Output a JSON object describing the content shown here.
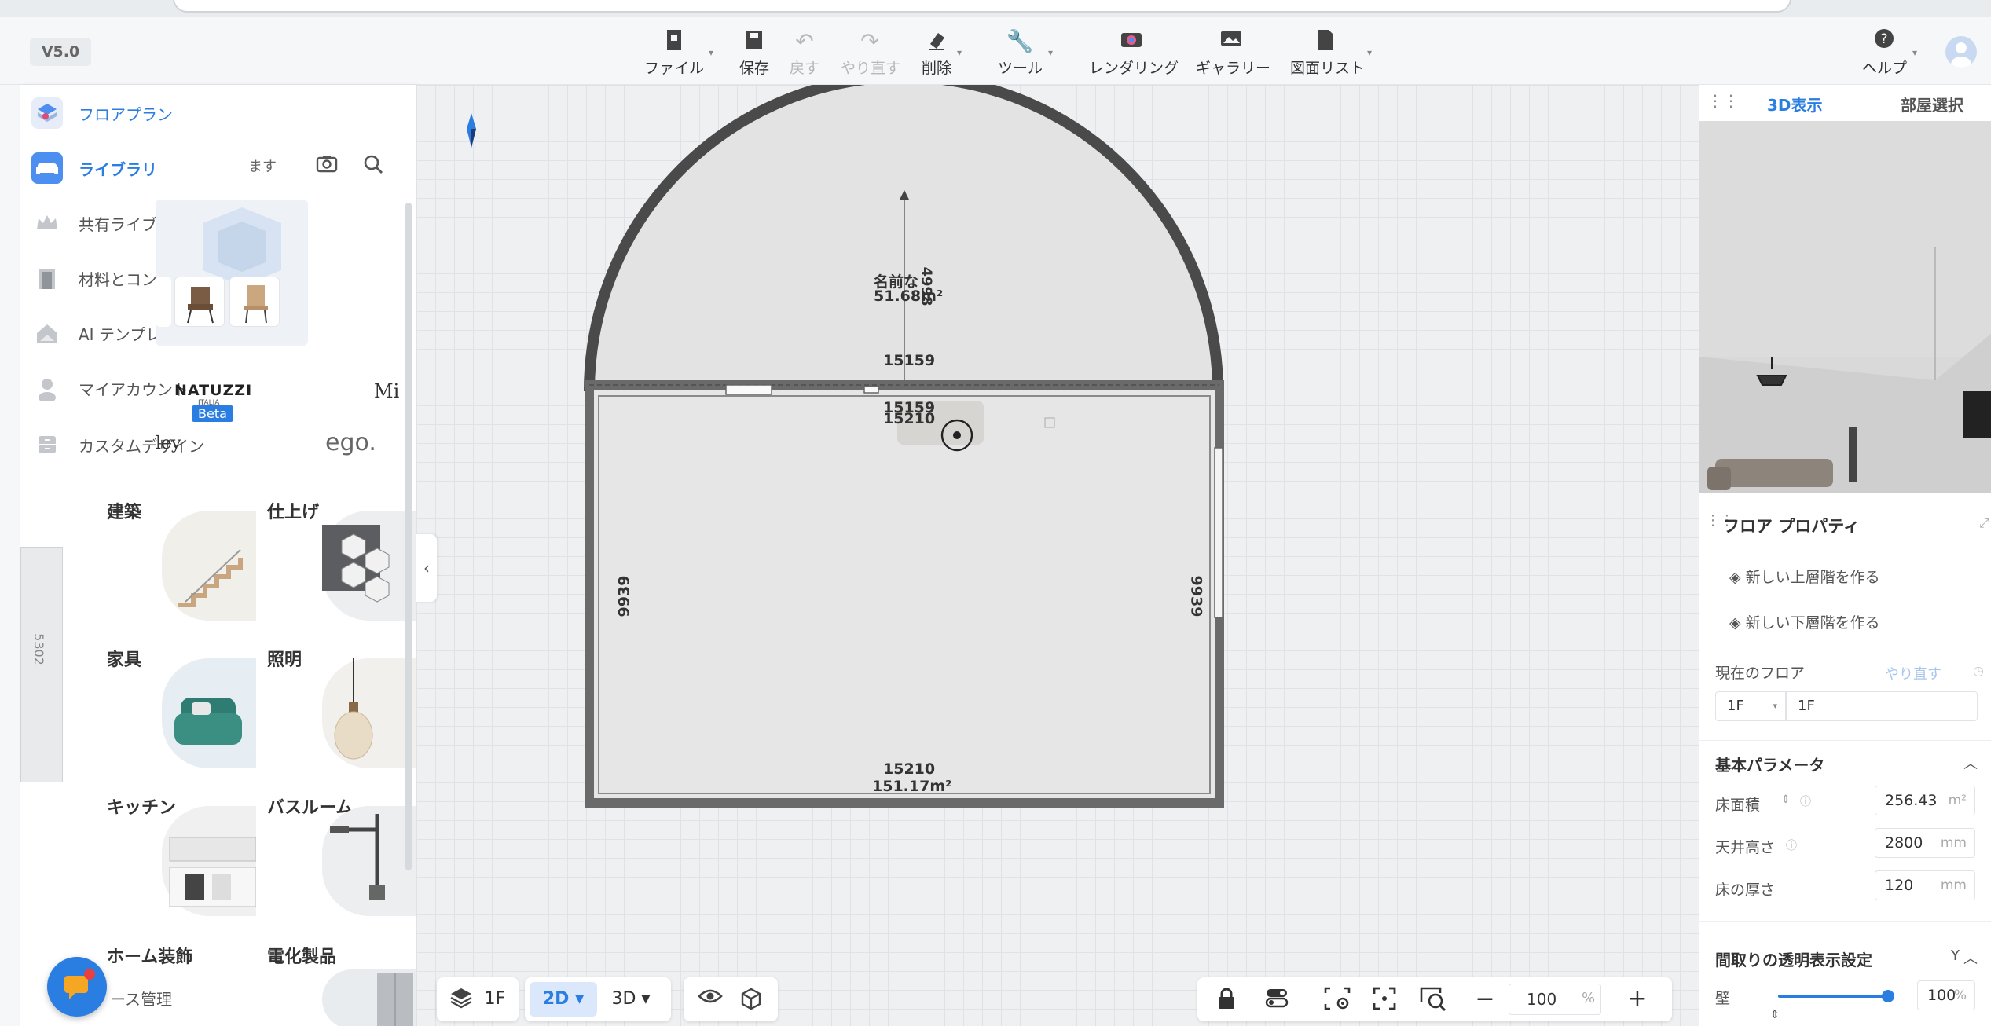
{
  "app": {
    "version": "V5.0"
  },
  "toolbar": {
    "file": "ファイル",
    "save": "保存",
    "undo": "戻す",
    "redo": "やり直す",
    "delete": "削除",
    "tools": "ツール",
    "render": "レンダリング",
    "gallery": "ギャラリー",
    "drawing_list": "図面リスト",
    "help": "ヘルプ"
  },
  "sidebar": {
    "floorplan": "フロアプラン",
    "library": "ライブラリ",
    "search_hint": "ます",
    "shared_library": "共有ライブラリ",
    "materials": "材料とコンポーネント",
    "ai_template": "AI テンプレート",
    "beta": "Beta",
    "my_account": "マイアカウント",
    "custom_design": "カスタムデザイン",
    "space_mgmt": "ース管理",
    "brands": [
      "NATUZZI",
      "ITALIA",
      "Mi",
      "ley",
      "ego."
    ],
    "categories": [
      {
        "label": "建築"
      },
      {
        "label": "仕上げ"
      },
      {
        "label": "家具"
      },
      {
        "label": "照明"
      },
      {
        "label": "キッチン"
      },
      {
        "label": "バスルーム"
      },
      {
        "label": "ホーム装飾"
      },
      {
        "label": "電化製品"
      }
    ],
    "ruler_label": "5302"
  },
  "plan": {
    "top_room_name": "名前な",
    "top_room_area": "51.68m²",
    "top_height_dim": "4998",
    "dim_top": "15159",
    "dim_top2": "15159",
    "dim_top3": "15210",
    "dim_left": "9939",
    "dim_right": "9939",
    "bottom_room_dim": "15210",
    "bottom_room_area": "151.17m²"
  },
  "right_panel": {
    "tab_3d": "3D表示",
    "tab_room": "部屋選択",
    "floor_props_title": "フロア プロパティ",
    "new_upper": "新しい上層階を作る",
    "new_lower": "新しい下層階を作る",
    "current_floor_label": "現在のフロア",
    "redo_hint": "やり直す",
    "floor_select": "1F",
    "floor_name": "1F",
    "basic_params": "基本パラメータ",
    "floor_area_label": "床面積",
    "floor_area_value": "256.43",
    "floor_area_unit": "m²",
    "ceiling_label": "天井高さ",
    "ceiling_value": "2800",
    "ceiling_unit": "mm",
    "thickness_label": "床の厚さ",
    "thickness_value": "120",
    "thickness_unit": "mm",
    "transparency_title": "間取りの透明表示設定",
    "transparency_key": "Y",
    "wall_label": "壁",
    "wall_value": "100",
    "wall_unit": "%",
    "wall_level": 1.0
  },
  "bottom_bar": {
    "floor": "1F",
    "mode_2d": "2D",
    "mode_3d": "3D",
    "zoom": "100",
    "zoom_unit": "%"
  },
  "colors": {
    "accent": "#2a7de1",
    "wall": "#4a4a4a"
  }
}
